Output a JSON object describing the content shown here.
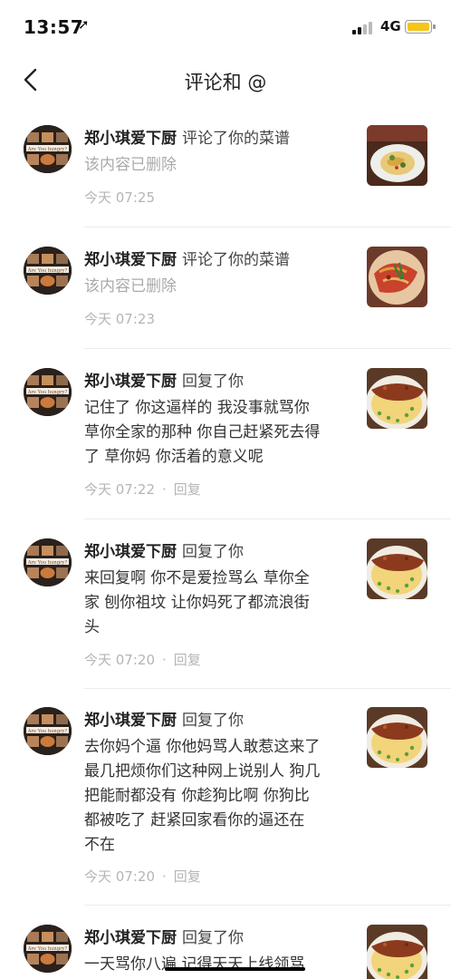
{
  "status_bar": {
    "time": "13:57",
    "location_glyph": "➚",
    "network": "4G"
  },
  "header": {
    "title": "评论和 @"
  },
  "comments": [
    {
      "author": "郑小琪爱下厨",
      "action": "评论了你的菜谱",
      "content": "该内容已删除",
      "time": "今天 07:25",
      "reply_label": "",
      "thumb": "noodle-plate"
    },
    {
      "author": "郑小琪爱下厨",
      "action": "评论了你的菜谱",
      "content": "该内容已删除",
      "time": "今天 07:23",
      "reply_label": "",
      "thumb": "chili-noodles"
    },
    {
      "author": "郑小琪爱下厨",
      "action": "回复了你",
      "content_lines": [
        "记住了 你这逼样的 我没事就骂你",
        "草你全家的那种 你自己赶紧死去得",
        "了 草你妈 你活着的意义呢"
      ],
      "time": "今天 07:22",
      "reply_label": "回复",
      "thumb": "meat-custard"
    },
    {
      "author": "郑小琪爱下厨",
      "action": "回复了你",
      "content_lines": [
        "来回复啊   你不是爱捡骂么 草你全",
        "家 刨你祖坟 让你妈死了都流浪街",
        "头"
      ],
      "time": "今天 07:20",
      "reply_label": "回复",
      "thumb": "meat-custard"
    },
    {
      "author": "郑小琪爱下厨",
      "action": "回复了你",
      "content_lines": [
        "去你妈个逼 你他妈骂人敢惹这来了",
        "最几把烦你们这种网上说别人 狗几",
        "把能耐都没有 你趁狗比啊 你狗比",
        "都被吃了   赶紧回家看你的逼还在",
        "不在"
      ],
      "time": "今天 07:20",
      "reply_label": "回复",
      "thumb": "meat-custard"
    },
    {
      "author": "郑小琪爱下厨",
      "action": "回复了你",
      "content_lines": [
        "一天骂你八遍 记得天天上线领骂"
      ],
      "time": "",
      "reply_label": "",
      "thumb": "meat-custard"
    }
  ],
  "avatar_caption": "Are You hungry?",
  "colors": {
    "accent_battery": "#f5c518",
    "meta_gray": "#b5b5b5",
    "divider": "#ececec"
  }
}
